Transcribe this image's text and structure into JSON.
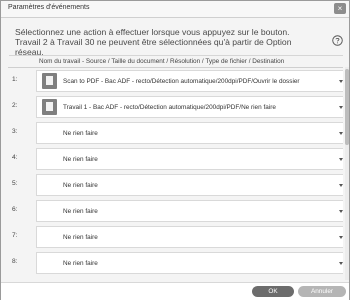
{
  "window": {
    "title": "Paramètres d'événements",
    "close_glyph": "×"
  },
  "instructions": {
    "line1": "Sélectionnez une action à effectuer lorsque vous appuyez sur le bouton.",
    "line2": "Travail 2 à Travail 30 ne peuvent être sélectionnées qu'à partir de Option réseau."
  },
  "help_icon": "question-circle-icon",
  "column_header": "Nom du travail  -  Source / Taille du document / Résolution / Type de fichier / Destination",
  "rows": [
    {
      "num": "1:",
      "label": "Scan to PDF - Bac ADF - recto/Détection automatique/200dpi/PDF/Ouvrir le dossier",
      "icon": "scan-document-icon"
    },
    {
      "num": "2:",
      "label": "Travail 1 - Bac ADF - recto/Détection automatique/200dpi/PDF/Ne rien faire",
      "icon": "scan-document-icon"
    },
    {
      "num": "3:",
      "label": "Ne rien faire"
    },
    {
      "num": "4:",
      "label": "Ne rien faire"
    },
    {
      "num": "5:",
      "label": "Ne rien faire"
    },
    {
      "num": "6:",
      "label": "Ne rien faire"
    },
    {
      "num": "7:",
      "label": "Ne rien faire"
    },
    {
      "num": "8:",
      "label": "Ne rien faire"
    }
  ],
  "buttons": {
    "ok": "OK",
    "cancel": "Annuler"
  }
}
